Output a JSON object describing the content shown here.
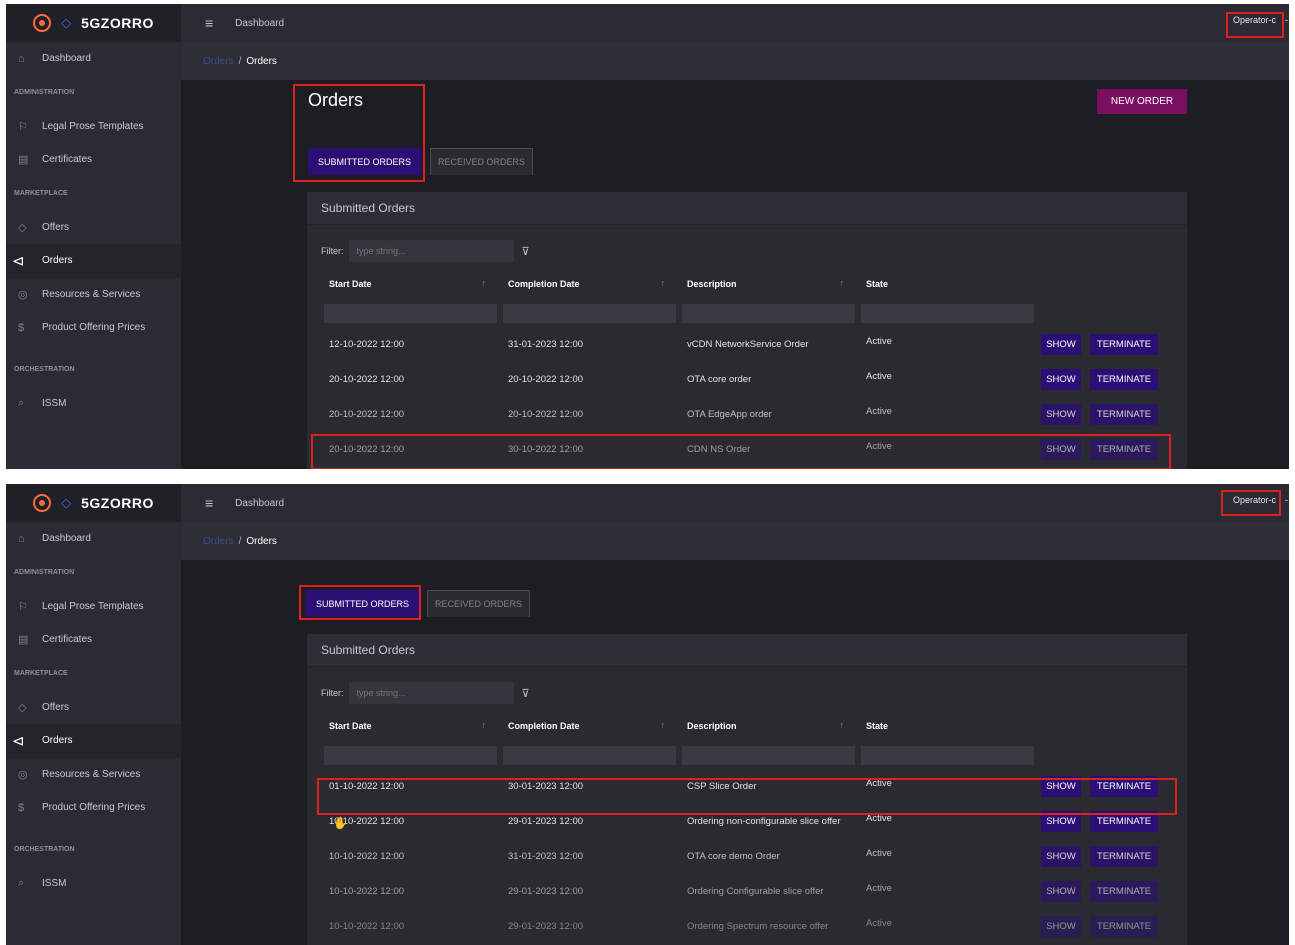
{
  "app": {
    "brand": "5GZORRO",
    "topbar_title": "Dashboard",
    "user": "Operator-c",
    "user_caret": "-"
  },
  "sidebar": {
    "dashboard": "Dashboard",
    "section_admin": "ADMINISTRATION",
    "legal": "Legal Prose Templates",
    "certificates": "Certificates",
    "section_marketplace": "MARKETPLACE",
    "offers": "Offers",
    "orders": "Orders",
    "resources": "Resources & Services",
    "prices": "Product Offering Prices",
    "section_orchestration": "ORCHESTRATION",
    "issm": "ISSM"
  },
  "breadcrumb": {
    "parent": "Orders",
    "separator": "/",
    "current": "Orders"
  },
  "page": {
    "title": "Orders",
    "new_order": "NEW ORDER",
    "tab_submitted": "SUBMITTED ORDERS",
    "tab_received": "RECEIVED ORDERS",
    "card_title": "Submitted Orders",
    "filter_label": "Filter:",
    "filter_placeholder": "type string..."
  },
  "table": {
    "columns": [
      "Start Date",
      "Completion Date",
      "Description",
      "State"
    ],
    "sort_glyph": "↑",
    "show_label": "SHOW",
    "terminate_label": "TERMINATE",
    "rows_top": [
      {
        "start": "12-10-2022 12:00",
        "completion": "31-01-2023 12:00",
        "description": "vCDN NetworkService Order",
        "state": "Active"
      },
      {
        "start": "20-10-2022 12:00",
        "completion": "20-10-2022 12:00",
        "description": "OTA core order",
        "state": "Active"
      },
      {
        "start": "20-10-2022 12:00",
        "completion": "20-10-2022 12:00",
        "description": "OTA EdgeApp order",
        "state": "Active"
      },
      {
        "start": "20-10-2022 12:00",
        "completion": "30-10-2022 12:00",
        "description": "CDN NS Order",
        "state": "Active"
      }
    ],
    "rows_bottom": [
      {
        "start": "01-10-2022 12:00",
        "completion": "30-01-2023 12:00",
        "description": "CSP Slice Order",
        "state": "Active"
      },
      {
        "start": "10-10-2022 12:00",
        "completion": "29-01-2023 12:00",
        "description": "Ordering non-configurable slice offer",
        "state": "Active"
      },
      {
        "start": "10-10-2022 12:00",
        "completion": "31-01-2023 12:00",
        "description": "OTA core demo Order",
        "state": "Active"
      },
      {
        "start": "10-10-2022 12:00",
        "completion": "29-01-2023 12:00",
        "description": "Ordering Configurable slice offer",
        "state": "Active"
      },
      {
        "start": "10-10-2022 12:00",
        "completion": "29-01-2023 12:00",
        "description": "Ordering Spectrum resource offer",
        "state": "Active"
      }
    ]
  },
  "icons": {
    "hamburger": "≡",
    "dashboard": "⌂",
    "legal": "⚐",
    "certificates": "▤",
    "offers": "◇",
    "orders": "⊲",
    "resources": "◎",
    "prices": "$",
    "issm": "⌕",
    "filter": "⊽",
    "cursor": "✋"
  },
  "colors": {
    "accent_purple": "#2c0f75",
    "new_order_magenta": "#7a0f62",
    "highlight_red": "#e02020",
    "brand_orange": "#ff6a3d"
  }
}
